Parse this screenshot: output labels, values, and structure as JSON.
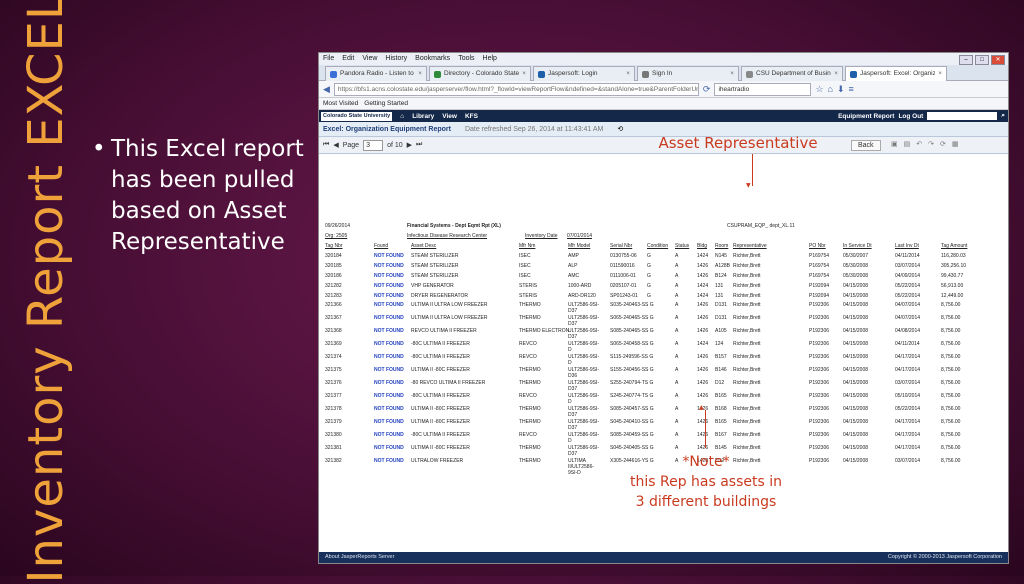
{
  "slide": {
    "vertical_title": "Inventory Report EXCEL",
    "bullet": "This Excel report has been pulled based on Asset Representative",
    "annotation_top": "Asset Representative",
    "note_title": "*Note*",
    "note_line1": "this Rep has assets in",
    "note_line2": "3 different buildings"
  },
  "browser": {
    "menu": [
      "File",
      "Edit",
      "View",
      "History",
      "Bookmarks",
      "Tools",
      "Help"
    ],
    "tabs": [
      {
        "label": "Pandora Radio - Listen to F...",
        "color": "#3a6fd8"
      },
      {
        "label": "Directory - Colorado State ...",
        "color": "#2f8a3a"
      },
      {
        "label": "Jaspersoft: Login",
        "color": "#1d5fa8"
      },
      {
        "label": "Sign In",
        "color": "#777777"
      },
      {
        "label": "CSU Department of Business a...",
        "color": "#888888"
      },
      {
        "label": "Jaspersoft: Excel: Organizat...",
        "color": "#1d5fa8"
      }
    ],
    "url": "https://bfs1.acns.colostate.edu/jasperserver/flow.html?_flowId=viewReportFlow&ndefined=&standAlone=true&ParentFolderUri=%2Freports%2FCan",
    "search": "iheartradio",
    "bookmarks": [
      "Most Visited",
      "Getting Started"
    ]
  },
  "app": {
    "logo": "Colorado State University",
    "nav": [
      "Library",
      "View",
      "KFS"
    ],
    "right_title": "Equipment Report",
    "logout": "Log Out"
  },
  "report": {
    "title": "Excel: Organization Equipment Report",
    "refreshed": "Date refreshed Sep 26, 2014 at 11:43:41 AM",
    "page_label": "Page",
    "page_num": "3",
    "page_of": "of 10",
    "back": "Back"
  },
  "sheet": {
    "date": "09/26/2014",
    "system": "Financial Systems - Dept Eqmt Rpt (XL)",
    "code": "CSUPRAM_EQP_ dept_XL.11",
    "org_label": "Org: 2505",
    "org_name": "Infectious Disease Research Center",
    "inv_label": "Inventory Date",
    "inv_date": "07/01/2014",
    "headers": [
      "Tag Nbr",
      "Found",
      "Asset Desc",
      "Mfr Nm",
      "Mfr Model",
      "Serial Nbr",
      "Condition",
      "Status",
      "Bldg",
      "Room",
      "Representative",
      "PO Nbr",
      "In Service Dt",
      "Last Inv Dt",
      "Tag Amount"
    ],
    "rows": [
      {
        "tag": "320184",
        "found": "NOT FOUND",
        "desc": "STEAM STERILIZER",
        "mfr": "ISEC",
        "model": "AMP",
        "serial": "0130755-06",
        "cond": "G",
        "status": "A",
        "bldg": "1424",
        "room": "N145",
        "rep": "Richter,Brett",
        "po": "P169754",
        "insvc": "05/30/2007",
        "lastinv": "04/11/2014",
        "amt": "116,280.03",
        "m2": "",
        "m3": ""
      },
      {
        "tag": "320185",
        "found": "NOT FOUND",
        "desc": "STEAM STERILIZER",
        "mfr": "ISEC",
        "model": "ALP",
        "serial": "011590016",
        "cond": "G",
        "status": "A",
        "bldg": "1426",
        "room": "A128B",
        "rep": "Richter,Brett",
        "po": "P169754",
        "insvc": "05/30/2008",
        "lastinv": "03/07/2014",
        "amt": "305,256.10",
        "m2": "",
        "m3": ""
      },
      {
        "tag": "320186",
        "found": "NOT FOUND",
        "desc": "STEAM STERILIZER",
        "mfr": "ISEC",
        "model": "AMC",
        "serial": "0111006-01",
        "cond": "G",
        "status": "A",
        "bldg": "1426",
        "room": "B124",
        "rep": "Richter,Brett",
        "po": "P169754",
        "insvc": "05/30/2008",
        "lastinv": "04/09/2014",
        "amt": "99,430.77",
        "m2": "",
        "m3": ""
      },
      {
        "tag": "321282",
        "found": "NOT FOUND",
        "desc": "VHP GENERATOR",
        "mfr": "STERIS",
        "model": "1000-ARD",
        "serial": "0205107-01",
        "cond": "G",
        "status": "A",
        "bldg": "1424",
        "room": "131",
        "rep": "Richter,Brett",
        "po": "P192094",
        "insvc": "04/15/2008",
        "lastinv": "05/22/2014",
        "amt": "56,913.00",
        "m2": "",
        "m3": ""
      },
      {
        "tag": "321283",
        "found": "NOT FOUND",
        "desc": "DRYER REGENERATOR",
        "mfr": "STERIS",
        "model": "ARD-DR120",
        "serial": "SP01243-01",
        "cond": "G",
        "status": "A",
        "bldg": "1424",
        "room": "131",
        "rep": "Richter,Brett",
        "po": "P192094",
        "insvc": "04/15/2008",
        "lastinv": "05/22/2014",
        "amt": "12,449.00",
        "m2": "",
        "m3": ""
      },
      {
        "tag": "321366",
        "found": "NOT FOUND",
        "desc": "ULTIMA II ULTRA LOW FREEZER",
        "mfr": "THERMO",
        "model": "ULT2586-9SI-",
        "serial": "S035-240463-SS G",
        "cond": "",
        "status": "A",
        "bldg": "1426",
        "room": "D131",
        "rep": "Richter,Brett",
        "po": "P192306",
        "insvc": "04/15/2008",
        "lastinv": "04/07/2014",
        "amt": "8,756.00",
        "m2": "D37",
        "m3": ""
      },
      {
        "tag": "321367",
        "found": "NOT FOUND",
        "desc": "ULTIMA II ULTRA LOW FREEZER",
        "mfr": "THERMO",
        "model": "ULT2586-9SI-",
        "serial": "S065-240465-SS G",
        "cond": "",
        "status": "A",
        "bldg": "1426",
        "room": "D131",
        "rep": "Richter,Brett",
        "po": "P192306",
        "insvc": "04/15/2008",
        "lastinv": "04/07/2014",
        "amt": "8,756.00",
        "m2": "D37",
        "m3": ""
      },
      {
        "tag": "321368",
        "found": "NOT FOUND",
        "desc": "REVCO ULTIMA II FREEZER",
        "mfr": "THERMO ELECTRON",
        "model": "ULT2586-9SI-",
        "serial": "S085-240465-SS G",
        "cond": "",
        "status": "A",
        "bldg": "1426",
        "room": "A105",
        "rep": "Richter,Brett",
        "po": "P192306",
        "insvc": "04/15/2008",
        "lastinv": "04/08/2014",
        "amt": "8,756.00",
        "m2": "D37",
        "m3": ""
      },
      {
        "tag": "321369",
        "found": "NOT FOUND",
        "desc": "-80C ULTIMA II FREEZER",
        "mfr": "REVCO",
        "model": "ULT2586-9SI-",
        "serial": "S065-240458-SS G",
        "cond": "",
        "status": "A",
        "bldg": "1424",
        "room": "124",
        "rep": "Richter,Brett",
        "po": "P192306",
        "insvc": "04/15/2008",
        "lastinv": "04/11/2014",
        "amt": "8,756.00",
        "m2": "D",
        "m3": ""
      },
      {
        "tag": "321374",
        "found": "NOT FOUND",
        "desc": "-80C ULTIMA II FREEZER",
        "mfr": "REVCO",
        "model": "ULT2586-9SI-",
        "serial": "S115-249596-SS G",
        "cond": "",
        "status": "A",
        "bldg": "1426",
        "room": "B157",
        "rep": "Richter,Brett",
        "po": "P192306",
        "insvc": "04/15/2008",
        "lastinv": "04/17/2014",
        "amt": "8,756.00",
        "m2": "D",
        "m3": ""
      },
      {
        "tag": "321375",
        "found": "NOT FOUND",
        "desc": "ULTIMA II -80C FREEZER",
        "mfr": "THERMO",
        "model": "ULT2586-9SI-",
        "serial": "S155-240456-SS G",
        "cond": "",
        "status": "A",
        "bldg": "1426",
        "room": "B146",
        "rep": "Richter,Brett",
        "po": "P192306",
        "insvc": "04/15/2008",
        "lastinv": "04/17/2014",
        "amt": "8,756.00",
        "m2": "D36",
        "m3": ""
      },
      {
        "tag": "321376",
        "found": "NOT FOUND",
        "desc": "-80 REVCO ULTIMA II FREEZER",
        "mfr": "THERMO",
        "model": "ULT2586-9SI-",
        "serial": "S255-240794-TS G",
        "cond": "",
        "status": "A",
        "bldg": "1426",
        "room": "D12",
        "rep": "Richter,Brett",
        "po": "P192306",
        "insvc": "04/15/2008",
        "lastinv": "03/07/2014",
        "amt": "8,756.00",
        "m2": "D37",
        "m3": ""
      },
      {
        "tag": "321377",
        "found": "NOT FOUND",
        "desc": "-80C ULTIMA II FREEZER",
        "mfr": "REVCO",
        "model": "ULT2586-9SI-",
        "serial": "S245-240774-TS G",
        "cond": "",
        "status": "A",
        "bldg": "1426",
        "room": "B165",
        "rep": "Richter,Brett",
        "po": "P192306",
        "insvc": "04/15/2008",
        "lastinv": "05/10/2014",
        "amt": "8,756.00",
        "m2": "D",
        "m3": ""
      },
      {
        "tag": "321378",
        "found": "NOT FOUND",
        "desc": "ULTIMA II -80C FREEZER",
        "mfr": "THERMO",
        "model": "ULT2586-9SI-",
        "serial": "S085-240457-SS G",
        "cond": "",
        "status": "A",
        "bldg": "1426",
        "room": "B168",
        "rep": "Richter,Brett",
        "po": "P192306",
        "insvc": "04/15/2008",
        "lastinv": "05/22/2014",
        "amt": "8,756.00",
        "m2": "D37",
        "m3": ""
      },
      {
        "tag": "321379",
        "found": "NOT FOUND",
        "desc": "ULTIMA II -80C FREEZER",
        "mfr": "THERMO",
        "model": "ULT2586-9SI-",
        "serial": "S045-240410-SS G",
        "cond": "",
        "status": "A",
        "bldg": "1426",
        "room": "B165",
        "rep": "Richter,Brett",
        "po": "P192306",
        "insvc": "04/15/2008",
        "lastinv": "04/17/2014",
        "amt": "8,756.00",
        "m2": "D37",
        "m3": ""
      },
      {
        "tag": "321380",
        "found": "NOT FOUND",
        "desc": "-80C ULTIMA II FREEZER",
        "mfr": "REVCO",
        "model": "ULT2586-9SI-",
        "serial": "S085-240459-SS G",
        "cond": "",
        "status": "A",
        "bldg": "1426",
        "room": "B167",
        "rep": "Richter,Brett",
        "po": "P192306",
        "insvc": "04/15/2008",
        "lastinv": "04/17/2014",
        "amt": "8,756.00",
        "m2": "D",
        "m3": ""
      },
      {
        "tag": "321381",
        "found": "NOT FOUND",
        "desc": "ULTIMA II -80C FREEZER",
        "mfr": "THERMO",
        "model": "ULT2586-9SI-",
        "serial": "S045-240405-SS G",
        "cond": "",
        "status": "A",
        "bldg": "1426",
        "room": "B145",
        "rep": "Richter,Brett",
        "po": "P192306",
        "insvc": "04/15/2008",
        "lastinv": "04/17/2014",
        "amt": "8,756.00",
        "m2": "D37",
        "m3": ""
      },
      {
        "tag": "321382",
        "found": "NOT FOUND",
        "desc": "ULTRALOW FREEZER",
        "mfr": "THERMO",
        "model": "ULTIMA",
        "serial": "X305-244616-YS G",
        "cond": "",
        "status": "A",
        "bldg": "1428",
        "room": "D12",
        "rep": "Richter,Brett",
        "po": "P192306",
        "insvc": "04/15/2008",
        "lastinv": "03/07/2014",
        "amt": "8,756.00",
        "m2": "II/ULT2586-",
        "m3": "9SI-D"
      }
    ]
  },
  "footer": {
    "left": "About JasperReports Server",
    "right": "Copyright © 2000-2013 Jaspersoft Corporation"
  },
  "colors": {
    "accent_orange": "#f0a23a",
    "annotation_red": "#c93a1f",
    "app_navy": "#14284a"
  }
}
